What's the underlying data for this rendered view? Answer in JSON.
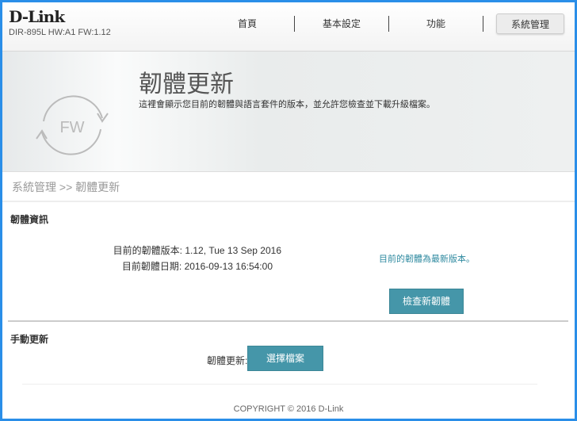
{
  "header": {
    "logo": "D-Link",
    "model": "DIR-895L HW:A1 FW:1.12",
    "nav": [
      "首頁",
      "基本設定",
      "功能",
      "系統管理"
    ]
  },
  "hero": {
    "title": "韌體更新",
    "description": "這裡會顯示您目前的韌體與語言套件的版本，並允許您檢查並下載升級檔案。",
    "icon_text": "FW"
  },
  "breadcrumb": "系統管理 >> 韌體更新",
  "info": {
    "heading": "韌體資訊",
    "version_label": "目前的韌體版本:",
    "version_value": "1.12, Tue 13 Sep 2016",
    "date_label": "目前韌體日期:",
    "date_value": "2016-09-13 16:54:00",
    "status": "目前的韌體為最新版本。",
    "check_button": "檢查新韌體"
  },
  "manual": {
    "heading": "手動更新",
    "label": "韌體更新:",
    "select_button": "選擇檔案"
  },
  "footer": "COPYRIGHT © 2016 D-Link"
}
